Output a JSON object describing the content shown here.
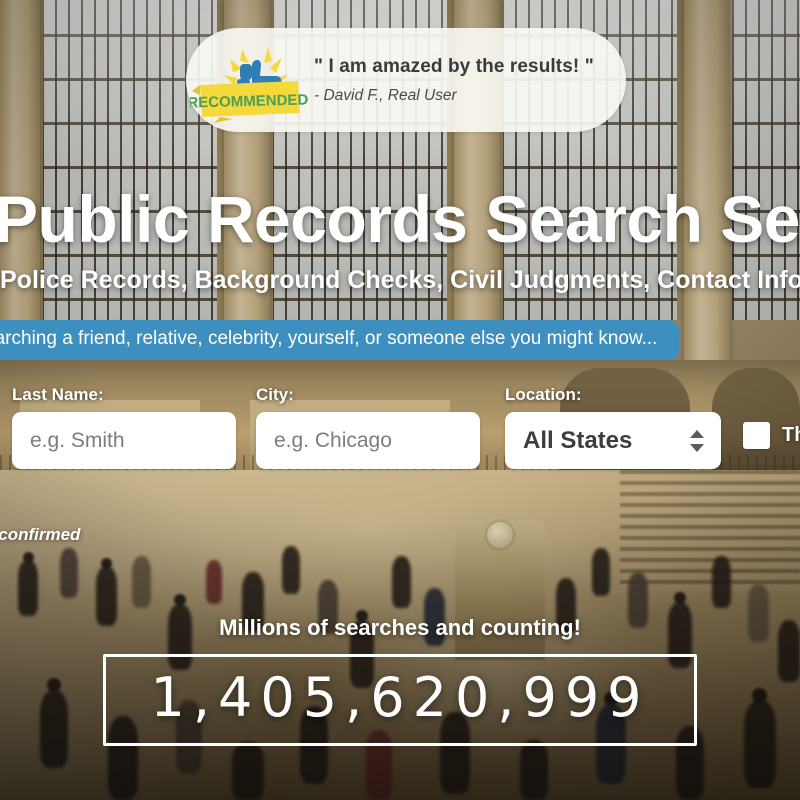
{
  "testimonial": {
    "badge_text": "RECOMMENDED",
    "badge_icon": "thumbs-up-icon",
    "quote": "\" I am amazed by the results! \"",
    "author": "- David F., Real User"
  },
  "hero": {
    "title": "Public Records Search Services",
    "subtitle": "Police Records, Background Checks, Civil Judgments, Contact Information"
  },
  "prompt": {
    "text": "Try searching a friend, relative, celebrity, yourself, or someone else you might know..."
  },
  "search_form": {
    "last_name": {
      "label": "Last Name:",
      "placeholder": "e.g. Smith",
      "value": ""
    },
    "city": {
      "label": "City:",
      "placeholder": "e.g. Chicago",
      "value": ""
    },
    "location": {
      "label": "Location:",
      "selected": "All States",
      "options": [
        "All States"
      ],
      "stepper_icon": "updown-arrows-icon"
    },
    "this_is_me": {
      "label": "This is me",
      "checked": false
    }
  },
  "disclaimer": {
    "text": "Information is not confirmed"
  },
  "counter": {
    "caption": "Millions of searches and counting!",
    "value": "1,405,620,999"
  },
  "colors": {
    "prompt_pill": "#3c8fbf",
    "badge_ribbon": "#f5d93c",
    "badge_text": "#4a9e5c",
    "thumb": "#2f7fb5",
    "counter_border": "#ffffff",
    "input_background": "#ffffff"
  }
}
